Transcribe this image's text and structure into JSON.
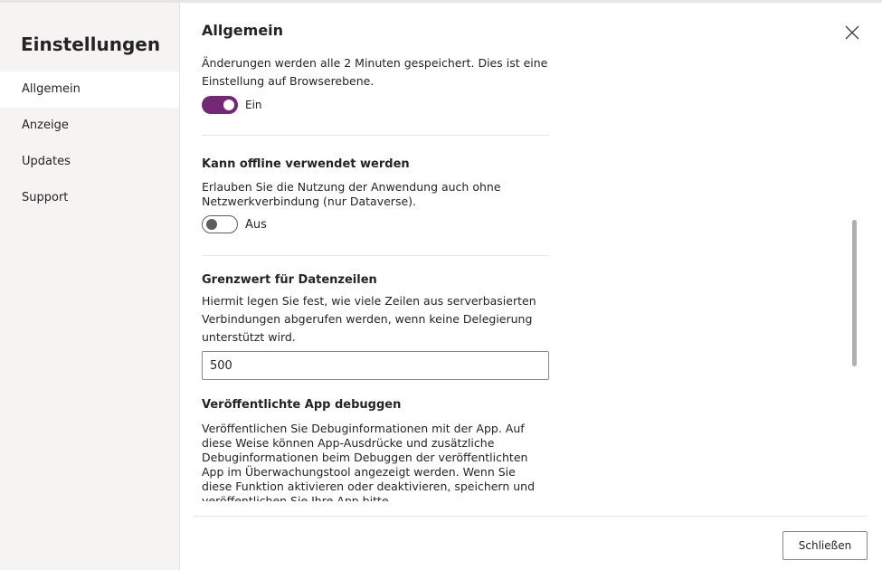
{
  "sidebar": {
    "title": "Einstellungen",
    "items": [
      {
        "label": "Allgemein",
        "active": true
      },
      {
        "label": "Anzeige"
      },
      {
        "label": "Updates"
      },
      {
        "label": "Support"
      }
    ]
  },
  "main": {
    "title": "Allgemein",
    "autosave": {
      "description": "Änderungen werden alle 2 Minuten gespeichert. Dies ist eine Einstellung auf Browserebene.",
      "toggle_label": "Ein",
      "enabled": true
    },
    "offline": {
      "title": "Kann offline verwendet werden",
      "description": "Erlauben Sie die Nutzung der Anwendung auch ohne Netzwerkverbindung (nur Dataverse).",
      "toggle_label": "Aus",
      "enabled": false
    },
    "row_limit": {
      "title": "Grenzwert für Datenzeilen",
      "description": "Hiermit legen Sie fest, wie viele Zeilen aus serverbasierten Verbindungen abgerufen werden, wenn keine Delegierung unterstützt wird.",
      "value": "500"
    },
    "debug": {
      "title": "Veröffentlichte App debuggen",
      "description": "Veröffentlichen Sie Debuginformationen mit der App. Auf diese Weise können App-Ausdrücke und zusätzliche Debuginformationen beim Debuggen der veröffentlichten App im Überwachungstool angezeigt werden. Wenn Sie diese Funktion aktivieren oder deaktivieren, speichern und veröffentlichen Sie Ihre App bitte."
    }
  },
  "footer": {
    "close_label": "Schließen"
  },
  "icons": {
    "close": "close-icon"
  },
  "colors": {
    "accent": "#742774",
    "sidebar_bg": "#f5f4f3"
  }
}
